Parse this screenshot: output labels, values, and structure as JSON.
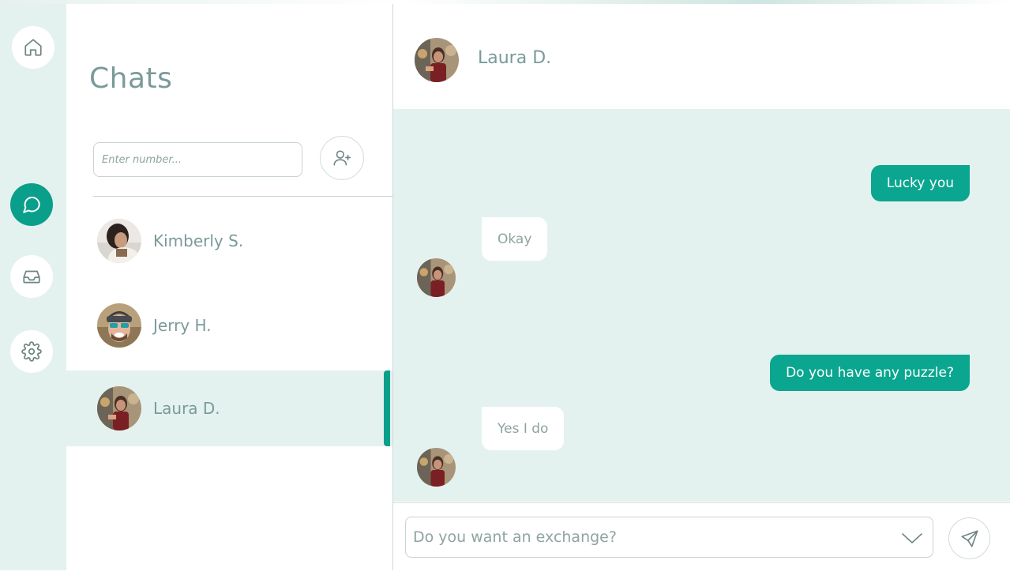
{
  "rail": {
    "items": [
      {
        "icon": "home-icon",
        "active": false
      },
      {
        "icon": "chat-bubble-icon",
        "active": true
      },
      {
        "icon": "inbox-icon",
        "active": false
      },
      {
        "icon": "gear-icon",
        "active": false
      }
    ]
  },
  "chats": {
    "title": "Chats",
    "number_input": {
      "placeholder": "Enter number...",
      "value": ""
    },
    "add_button_icon": "add-user-icon",
    "contacts": [
      {
        "name": "Kimberly S.",
        "selected": false
      },
      {
        "name": "Jerry H.",
        "selected": false
      },
      {
        "name": "Laura D.",
        "selected": true
      }
    ]
  },
  "conversation": {
    "contact_name": "Laura D.",
    "messages": [
      {
        "direction": "out",
        "text": "Lucky you"
      },
      {
        "direction": "in",
        "text": "Okay"
      },
      {
        "direction": "out",
        "text": "Do you have any puzzle?"
      },
      {
        "direction": "in",
        "text": "Yes I do"
      }
    ]
  },
  "composer": {
    "text": "Do you want an exchange?",
    "dropdown_icon": "chevron-down-icon",
    "send_icon": "send-icon"
  },
  "colors": {
    "accent": "#0a9f8a",
    "panel_bg": "#e4f2ef",
    "text_muted": "#7a9a9a"
  }
}
